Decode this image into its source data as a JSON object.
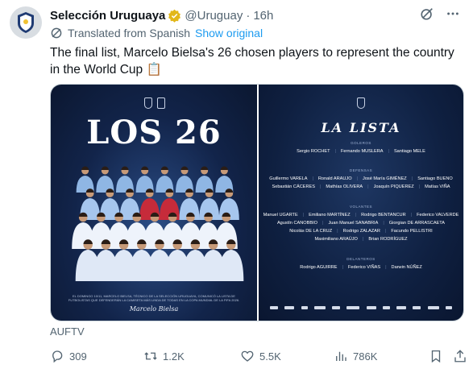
{
  "post": {
    "author_name": "Selección Uruguaya",
    "handle": "@Uruguay",
    "separator": "·",
    "time": "16h",
    "translated_label": "Translated from Spanish",
    "show_original_label": "Show original",
    "text": "The final list, Marcelo Bielsa's 26 chosen players to represent the country in the World Cup 📋",
    "source": "AUFTV"
  },
  "media": {
    "left": {
      "title": "LOS 26",
      "footer_text": "EL DOMINGO 10/11, MARCELO BIELSA, TÉCNICO DE LA SELECCIÓN URUGUAYA, COMUNICÓ LA LISTA DE FUTBOLISTAS QUE DEFENDERÁN LA CAMISETA MÁS LINDA DE TODAS EN LA COPA MUNDIAL DE LA FIFA 2026.",
      "signature": "Marcelo Bielsa"
    },
    "right": {
      "title": "LA LISTA",
      "sections": [
        {
          "title": "GOLEROS",
          "rows": [
            [
              "Sergio ROCHET",
              "Fernando MUSLERA",
              "Santiago MELE"
            ]
          ]
        },
        {
          "title": "DEFENSAS",
          "rows": [
            [
              "Guillermo VARELA",
              "Ronald ARAUJO",
              "José María GIMÉNEZ",
              "Santiago BUENO"
            ],
            [
              "Sebastián CÁCERES",
              "Mathías OLIVERA",
              "Joaquín PIQUEREZ",
              "Matías VIÑA"
            ]
          ]
        },
        {
          "title": "VOLANTES",
          "rows": [
            [
              "Manuel UGARTE",
              "Emiliano MARTÍNEZ",
              "Rodrigo BENTANCUR",
              "Federico VALVERDE"
            ],
            [
              "Agustín CANOBBIO",
              "Juan Manuel SANABRIA",
              "Giorgian DE ARRASCAETA"
            ],
            [
              "Nicolás DE LA CRUZ",
              "Rodrigo ZALAZAR",
              "Facundo PELLISTRI"
            ],
            [
              "Maximiliano ARAÚJO",
              "Brian RODRÍGUEZ"
            ]
          ]
        },
        {
          "title": "DELANTEROS",
          "rows": [
            [
              "Rodrigo AGUIRRE",
              "Federico VIÑAS",
              "Darwin NÚÑEZ"
            ]
          ]
        }
      ]
    }
  },
  "actions": {
    "replies": "309",
    "reposts": "1.2K",
    "likes": "5.5K",
    "views": "786K"
  },
  "colors": {
    "link": "#1d9bf0",
    "verified": "#e2b719",
    "muted": "#536471",
    "poster_navy": "#12244a"
  },
  "icons": {
    "verified": "verified-badge-icon",
    "grok": "grok-icon",
    "more": "more-icon",
    "translate": "translate-icon",
    "reply": "reply-icon",
    "repost": "repost-icon",
    "like": "like-icon",
    "views": "views-icon",
    "bookmark": "bookmark-icon",
    "share": "share-icon"
  }
}
